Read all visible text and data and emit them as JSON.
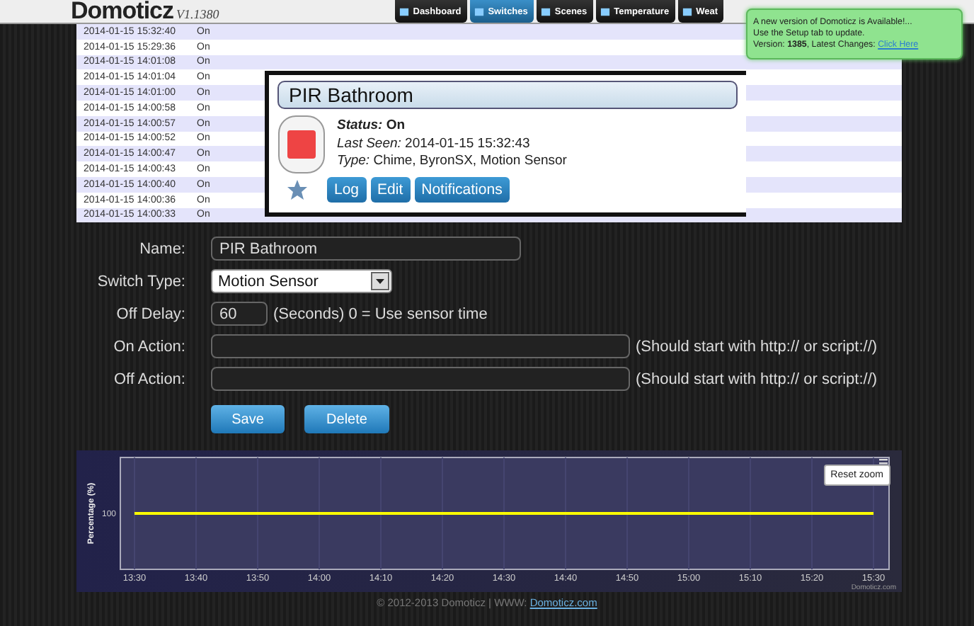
{
  "header": {
    "logo": "Domoticz",
    "version": "V1.1380",
    "tabs": [
      {
        "label": "Dashboard",
        "selected": false
      },
      {
        "label": "Switches",
        "selected": true
      },
      {
        "label": "Scenes",
        "selected": false
      },
      {
        "label": "Temperature",
        "selected": false
      },
      {
        "label": "Weat",
        "selected": false
      }
    ]
  },
  "notification": {
    "lines": [
      "A new version of Domoticz is Available!...",
      "Use the Setup tab to update."
    ],
    "version_text": "Version: **1385**, Latest Changes: ",
    "link": "Click Here"
  },
  "log": {
    "rows": [
      {
        "date": "2014-01-15 15:32:40",
        "state": "On"
      },
      {
        "date": "2014-01-15 15:29:36",
        "state": "On"
      },
      {
        "date": "2014-01-15 14:01:08",
        "state": "On"
      },
      {
        "date": "2014-01-15 14:01:04",
        "state": "On"
      },
      {
        "date": "2014-01-15 14:01:00",
        "state": "On"
      },
      {
        "date": "2014-01-15 14:00:58",
        "state": "On"
      },
      {
        "date": "2014-01-15 14:00:57",
        "state": "On"
      },
      {
        "date": "2014-01-15 14:00:52",
        "state": "On"
      },
      {
        "date": "2014-01-15 14:00:47",
        "state": "On"
      },
      {
        "date": "2014-01-15 14:00:43",
        "state": "On"
      },
      {
        "date": "2014-01-15 14:00:40",
        "state": "On"
      },
      {
        "date": "2014-01-15 14:00:36",
        "state": "On"
      },
      {
        "date": "2014-01-15 14:00:33",
        "state": "On"
      }
    ]
  },
  "device": {
    "name": "PIR Bathroom",
    "status_label": "Status:",
    "status": "On",
    "last_seen_label": "Last Seen:",
    "last_seen": "2014-01-15 15:32:43",
    "type_label": "Type:",
    "type": "Chime, ByronSX, Motion Sensor",
    "favorite": false,
    "buttons": [
      "Log",
      "Edit",
      "Notifications"
    ]
  },
  "form": {
    "fields": [
      {
        "kind": "text",
        "label": "Name:",
        "value": "PIR Bathroom"
      },
      {
        "kind": "select",
        "label": "Switch Type:",
        "value": "Motion Sensor"
      },
      {
        "kind": "number",
        "label": "Off Delay:",
        "value": "60",
        "hint": "(Seconds) 0 = Use sensor time"
      },
      {
        "kind": "wide",
        "label": "On Action:",
        "hint": "(Should start with http:// or script://)"
      },
      {
        "kind": "wide",
        "label": "Off Action:",
        "hint": "(Should start with http:// or script://)"
      }
    ],
    "buttons": [
      "Save",
      "Delete"
    ]
  },
  "chart": {
    "reset_button": "Reset zoom",
    "credit": "Domoticz.com",
    "ylabel": "Percentage (%)",
    "y_labels": [
      "100"
    ],
    "x_labels": [
      "13:30",
      "13:40",
      "13:50",
      "14:00",
      "14:10",
      "14:20",
      "14:30",
      "14:40",
      "14:50",
      "15:00",
      "15:10",
      "15:20",
      "15:30"
    ]
  },
  "footer": {
    "text": "© 2012-2013 Domoticz | WWW: ",
    "link": "Domoticz.com"
  }
}
